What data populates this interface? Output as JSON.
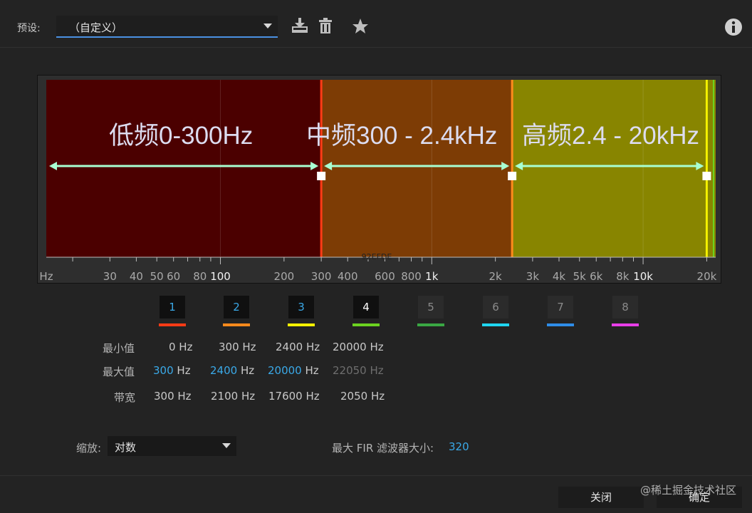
{
  "header": {
    "preset_label": "预设:",
    "preset_value": "（自定义）",
    "icons": [
      "save-preset-icon",
      "delete-preset-icon",
      "favorite-star-icon",
      "info-icon"
    ]
  },
  "graph": {
    "bands": [
      {
        "label": "低频0-300Hz",
        "from_hz": 0,
        "to_hz": 300,
        "fill": "#4b0000"
      },
      {
        "label": "中频300 - 2.4kHz",
        "from_hz": 300,
        "to_hz": 2400,
        "fill": "#7d3c05"
      },
      {
        "label": "高频2.4 - 20kHz",
        "from_hz": 2400,
        "to_hz": 20000,
        "fill": "#888500"
      }
    ],
    "divider_colors": {
      "red": "#ff3b16",
      "orange": "#ff8a1c",
      "yellow": "#f4f000",
      "green": "#6cd320"
    },
    "arrow_color": "#a8ffd2",
    "center_note": "92EFDE",
    "axis_labels": [
      "Hz",
      "30",
      "40",
      "50",
      "60",
      "80",
      "100",
      "200",
      "300",
      "400",
      "600",
      "800",
      "1k",
      "2k",
      "3k",
      "4k",
      "5k",
      "6k",
      "8k",
      "10k",
      "20k"
    ],
    "axis_label_hz": [
      15,
      30,
      40,
      50,
      60,
      80,
      100,
      200,
      300,
      400,
      600,
      800,
      1000,
      2000,
      3000,
      4000,
      5000,
      6000,
      8000,
      10000,
      20000
    ],
    "bold_labels": [
      "100",
      "1k",
      "10k"
    ]
  },
  "channels": [
    {
      "num": "1",
      "color": "#ff3b16",
      "active": true
    },
    {
      "num": "2",
      "color": "#ff8a1c",
      "active": true
    },
    {
      "num": "3",
      "color": "#f4f000",
      "active": true
    },
    {
      "num": "4",
      "color": "#6cd320",
      "active": true
    },
    {
      "num": "5",
      "color": "#3aa743",
      "active": false
    },
    {
      "num": "6",
      "color": "#1fd6f0",
      "active": false
    },
    {
      "num": "7",
      "color": "#2e8de8",
      "active": false
    },
    {
      "num": "8",
      "color": "#e83ee8",
      "active": false
    }
  ],
  "table": {
    "labels": {
      "min": "最小值",
      "max": "最大值",
      "bandwidth": "带宽"
    },
    "min": [
      "0 Hz",
      "300 Hz",
      "2400 Hz",
      "20000 Hz"
    ],
    "max": [
      {
        "num": "300",
        "unit": "Hz"
      },
      {
        "num": "2400",
        "unit": "Hz"
      },
      {
        "num": "20000",
        "unit": "Hz"
      },
      {
        "num": "22050",
        "unit": "Hz"
      }
    ],
    "bandwidth": [
      "300 Hz",
      "2100 Hz",
      "17600 Hz",
      "2050 Hz"
    ]
  },
  "footer": {
    "scale_label": "缩放:",
    "scale_value": "对数",
    "fir_label": "最大 FIR 滤波器大小:",
    "fir_value": "320",
    "close_button": "关闭",
    "ok_button": "确定",
    "watermark": "@稀土掘金技术社区"
  }
}
